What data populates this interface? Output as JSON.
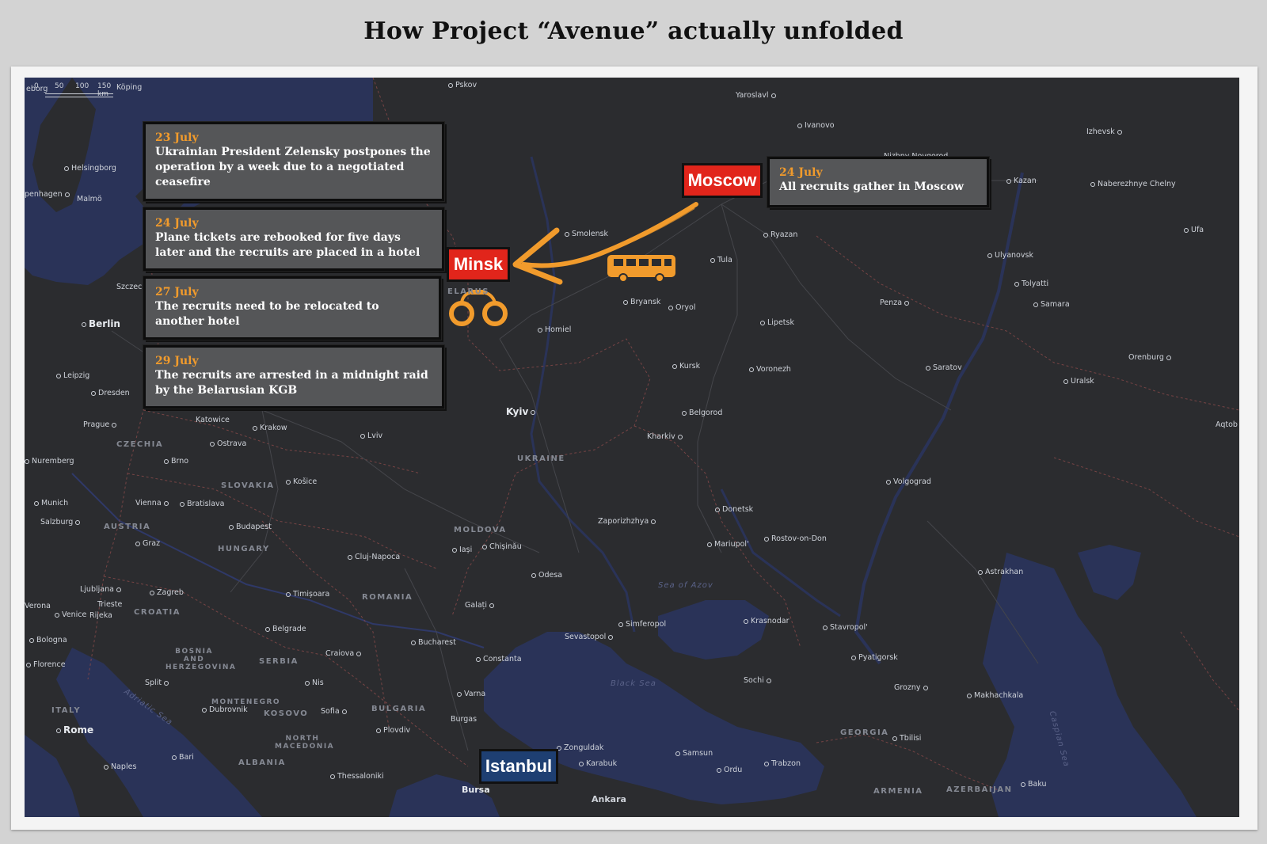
{
  "title": "How Project “Avenue” actually unfolded",
  "scale": {
    "labels": [
      "0",
      "50",
      "100",
      "150 km"
    ]
  },
  "timeline": [
    {
      "date": "23 July",
      "text": "Ukrainian President Zelensky postpones the operation by a week due to a negotiated ceasefire"
    },
    {
      "date": "24 July",
      "text": "Plane tickets are rebooked for five days later and the recruits are placed in a hotel"
    },
    {
      "date": "27 July",
      "text": "The recruits need to be relocated to another hotel"
    },
    {
      "date": "29 July",
      "text": "The recruits are arrested in a midnight raid by the Belarusian KGB"
    }
  ],
  "moscow_card": {
    "date": "24 July",
    "text": "All recruits gather in Moscow"
  },
  "markers": {
    "moscow": "Moscow",
    "minsk": "Minsk",
    "istanbul": "Istanbul"
  },
  "icons": [
    "bus-icon",
    "handcuffs-icon",
    "arrow-icon"
  ],
  "colors": {
    "accent_orange": "#f19b2c",
    "marker_red": "#e1251b",
    "marker_blue": "#1e3f72",
    "land": "#2b2c2f",
    "water": "#2a3358"
  },
  "cities": {
    "pskov": "Pskov",
    "yaroslavl": "Yaroslavl",
    "ivanovo": "Ivanovo",
    "izhevsk": "Izhevsk",
    "kazan": "Kazan",
    "naberezhnye": "Naberezhnye Chelny",
    "ufa": "Ufa",
    "nizhny": "Nizhny Novgorod",
    "helsingborg": "Helsingborg",
    "copenhagen": "penhagen",
    "malmo": "Malmö",
    "smolensk": "Smolensk",
    "ryazan": "Ryazan",
    "tula": "Tula",
    "ulyanovsk": "Ulyanovsk",
    "tolyatti": "Tolyatti",
    "samara": "Samara",
    "szczecin": "Szczecin",
    "berlin": "Berlin",
    "bryansk": "Bryansk",
    "oryol": "Oryol",
    "penza": "Penza",
    "homiel": "Homiel",
    "lipetsk": "Lipetsk",
    "kursk": "Kursk",
    "voronezh": "Voronezh",
    "saratov": "Saratov",
    "orenburg": "Orenburg",
    "uralsk": "Uralsk",
    "leipzig": "Leipzig",
    "dresden": "Dresden",
    "kyiv": "Kyiv",
    "belgorod": "Belgorod",
    "kharkiv": "Kharkiv",
    "aqtobe": "Aqtob",
    "katowice": "Katowice",
    "krakow": "Krakow",
    "prague": "Prague",
    "lviv": "Lviv",
    "ostrava": "Ostrava",
    "nuremberg": "Nuremberg",
    "brno": "Brno",
    "kosice": "Košice",
    "volgograd": "Volgograd",
    "munich": "Munich",
    "vienna": "Vienna",
    "bratislava": "Bratislava",
    "donetsk": "Donetsk",
    "zaporizhzhya": "Zaporizhzhya",
    "salzburg": "Salzburg",
    "budapest": "Budapest",
    "chisinau": "Chișinău",
    "mariupol": "Mariupol'",
    "rostov": "Rostov-on-Don",
    "graz": "Graz",
    "iasi": "Iași",
    "cluj": "Cluj-Napoca",
    "odesa": "Odesa",
    "astrakhan": "Astrakhan",
    "ljubljana": "Ljubljana",
    "zagreb": "Zagreb",
    "timisoara": "Timișoara",
    "verona": "Verona",
    "venice": "Venice",
    "trieste": "Trieste",
    "rijeka": "Rijeka",
    "galati": "Galați",
    "simferopol": "Simferopol",
    "krasnodar": "Krasnodar",
    "stavropol": "Stavropol'",
    "belgrade": "Belgrade",
    "bologna": "Bologna",
    "sevastopol": "Sevastopol",
    "bucharest": "Bucharest",
    "craiova": "Craiova",
    "constanta": "Constanta",
    "pyatigorsk": "Pyatigorsk",
    "florence": "Florence",
    "nis": "Nis",
    "split": "Split",
    "sochi": "Sochi",
    "grozny": "Grozny",
    "makhachkala": "Makhachkala",
    "varna": "Varna",
    "dubrovnik": "Dubrovnik",
    "sofia": "Sofia",
    "burgas": "Burgas",
    "plovdiv": "Plovdiv",
    "rome": "Rome",
    "tbilisi": "Tbilisi",
    "zonguldak": "Zonguldak",
    "samsun": "Samsun",
    "bari": "Bari",
    "karabuk": "Karabuk",
    "naples": "Naples",
    "ordu": "Ordu",
    "trabzon": "Trabzon",
    "thessaloniki": "Thessaloniki",
    "bursa": "Bursa",
    "baku": "Baku",
    "ankara": "Ankara",
    "koping": "Köping",
    "goteborg": "eborg"
  },
  "countries": {
    "czechia": "CZECHIA",
    "slovakia": "SLOVAKIA",
    "austria": "AUSTRIA",
    "hungary": "HUNGARY",
    "ukraine": "UKRAINE",
    "moldova": "MOLDOVA",
    "romania": "ROMANIA",
    "croatia": "CROATIA",
    "bosnia": "BOSNIA AND HERZEGOVINA",
    "serbia": "SERBIA",
    "montenegro": "MONTENEGRO",
    "kosovo": "KOSOVO",
    "bulgaria": "BULGARIA",
    "north_macedonia": "NORTH MACEDONIA",
    "italy": "ITALY",
    "albania": "ALBANIA",
    "georgia": "GEORGIA",
    "armenia": "ARMENIA",
    "azerbaijan": "AZERBAIJAN",
    "belarus": "ELARUS"
  },
  "seas": {
    "azov": "Sea of Azov",
    "black": "Black Sea",
    "adriatic": "Adriatic Sea",
    "caspian": "Caspian Sea"
  }
}
